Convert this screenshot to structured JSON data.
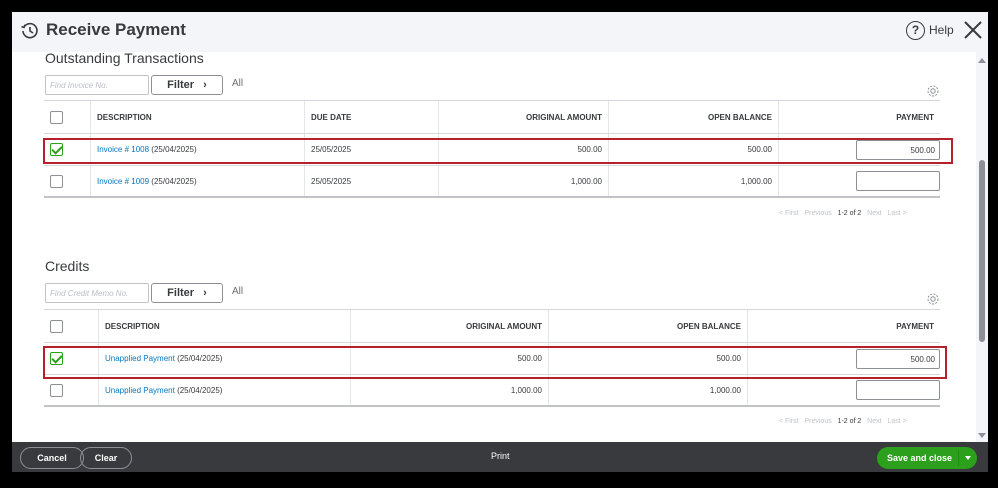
{
  "header": {
    "title": "Receive Payment",
    "help_label": "Help"
  },
  "outstanding": {
    "section_title": "Outstanding Transactions",
    "search_placeholder": "Find Invoice No.",
    "filter_label": "Filter",
    "all_label": "All",
    "columns": [
      "DESCRIPTION",
      "DUE DATE",
      "ORIGINAL AMOUNT",
      "OPEN BALANCE",
      "PAYMENT"
    ],
    "rows": [
      {
        "checked": true,
        "link": "Invoice # 1008",
        "date_suffix": "(25/04/2025)",
        "due_date": "25/05/2025",
        "original_amount": "500.00",
        "open_balance": "500.00",
        "payment": "500.00"
      },
      {
        "checked": false,
        "link": "Invoice # 1009",
        "date_suffix": "(25/04/2025)",
        "due_date": "25/05/2025",
        "original_amount": "1,000.00",
        "open_balance": "1,000.00",
        "payment": ""
      }
    ],
    "pager": {
      "first": "< First",
      "previous": "Previous",
      "range": "1-2 of 2",
      "next": "Next",
      "last": "Last >"
    }
  },
  "credits": {
    "section_title": "Credits",
    "search_placeholder": "Find Credit Memo No.",
    "filter_label": "Filter",
    "all_label": "All",
    "columns": [
      "DESCRIPTION",
      "ORIGINAL AMOUNT",
      "OPEN BALANCE",
      "PAYMENT"
    ],
    "rows": [
      {
        "checked": true,
        "link": "Unapplied Payment",
        "date_suffix": "(25/04/2025)",
        "original_amount": "500.00",
        "open_balance": "500.00",
        "payment": "500.00"
      },
      {
        "checked": false,
        "link": "Unapplied Payment",
        "date_suffix": "(25/04/2025)",
        "original_amount": "1,000.00",
        "open_balance": "1,000.00",
        "payment": ""
      }
    ],
    "pager": {
      "first": "< First",
      "previous": "Previous",
      "range": "1-2 of 2",
      "next": "Next",
      "last": "Last >"
    }
  },
  "footer": {
    "cancel_label": "Cancel",
    "clear_label": "Clear",
    "print_label": "Print",
    "save_label": "Save and close"
  },
  "colors": {
    "accent_green": "#2ca01c",
    "link_blue": "#0077c5",
    "highlight_red": "#b5202a",
    "footer_bg": "#393a3d"
  }
}
